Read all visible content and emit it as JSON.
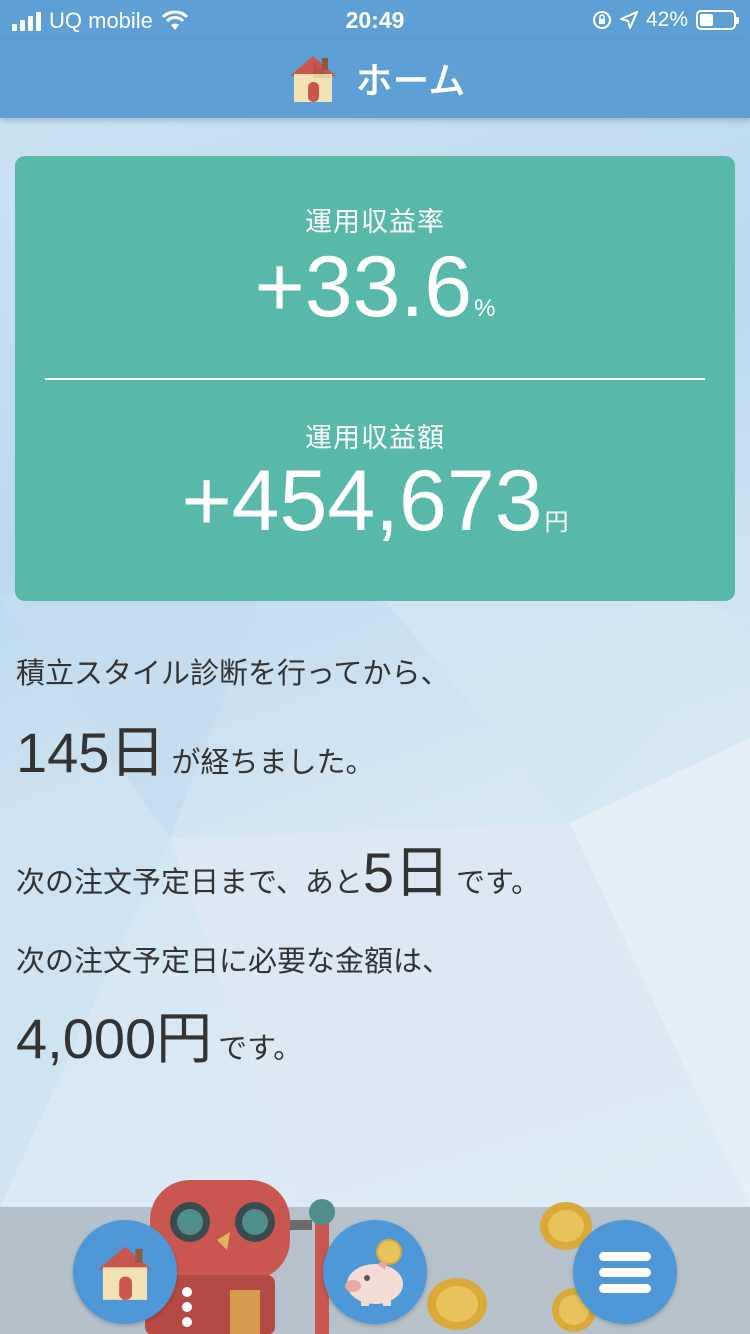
{
  "status_bar": {
    "carrier": "UQ mobile",
    "time": "20:49",
    "battery_percent": "42%",
    "battery_level": 0.42
  },
  "header": {
    "title": "ホーム",
    "icon": "house-icon"
  },
  "summary": {
    "rate_label": "運用収益率",
    "rate_value": "+33.6",
    "rate_unit": "%",
    "amount_label": "運用収益額",
    "amount_value": "+454,673",
    "amount_unit": "円"
  },
  "info": {
    "diagnosis_prefix": "積立スタイル診断を行ってから、",
    "days_elapsed": "145",
    "days_unit": "日",
    "days_suffix": "が経ちました。",
    "next_order_prefix": "次の注文予定日まで、あと",
    "days_until": "5",
    "days_until_unit": "日",
    "next_order_suffix": "です。",
    "required_prefix": "次の注文予定日に必要な金額は、",
    "required_amount": "4,000",
    "required_unit": "円",
    "required_suffix": "です。"
  },
  "bottom_nav": {
    "items": [
      {
        "icon": "house-icon",
        "name": "home"
      },
      {
        "icon": "piggy-bank-icon",
        "name": "savings"
      },
      {
        "icon": "menu-icon",
        "name": "menu"
      }
    ]
  },
  "colors": {
    "header_blue": "#5ea0d6",
    "card_teal": "#58b9ab",
    "nav_button_blue": "#4f98d8"
  }
}
